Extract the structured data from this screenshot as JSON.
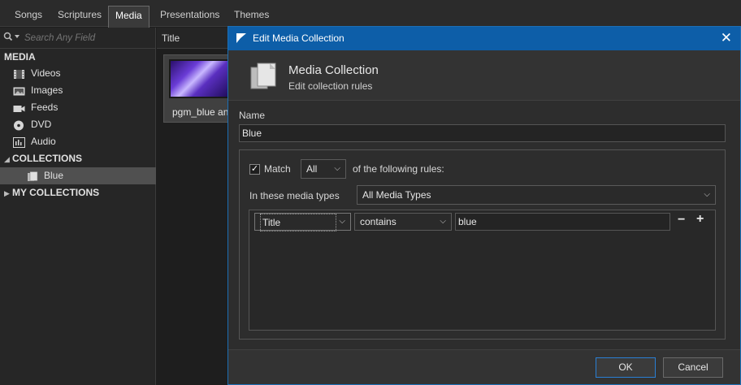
{
  "top_tabs": [
    "Songs",
    "Scriptures",
    "Media",
    "Presentations",
    "Themes"
  ],
  "active_tab": "Media",
  "sidebar": {
    "search_placeholder": "Search Any Field",
    "media_header": "MEDIA",
    "media_items": [
      "Videos",
      "Images",
      "Feeds",
      "DVD",
      "Audio"
    ],
    "collections_header": "COLLECTIONS",
    "collection_items": [
      "Blue"
    ],
    "my_collections_header": "MY COLLECTIONS"
  },
  "list": {
    "column_title": "Title",
    "items": [
      {
        "label": "pgm_blue and purple"
      }
    ]
  },
  "dialog": {
    "title": "Edit Media Collection",
    "heading": "Media Collection",
    "subheading": "Edit collection rules",
    "name_label": "Name",
    "name_value": "Blue",
    "match_checked": true,
    "match_label": "Match",
    "match_mode": "All",
    "match_suffix": "of the following rules:",
    "media_types_label": "In these media types",
    "media_types_value": "All Media Types",
    "rules": [
      {
        "field": "Title",
        "operator": "contains",
        "value": "blue"
      }
    ],
    "remove_label": "−",
    "add_label": "+",
    "ok_label": "OK",
    "cancel_label": "Cancel"
  },
  "colors": {
    "accent": "#0d5ea8",
    "selection": "#505050",
    "background": "#1e1e1e"
  }
}
